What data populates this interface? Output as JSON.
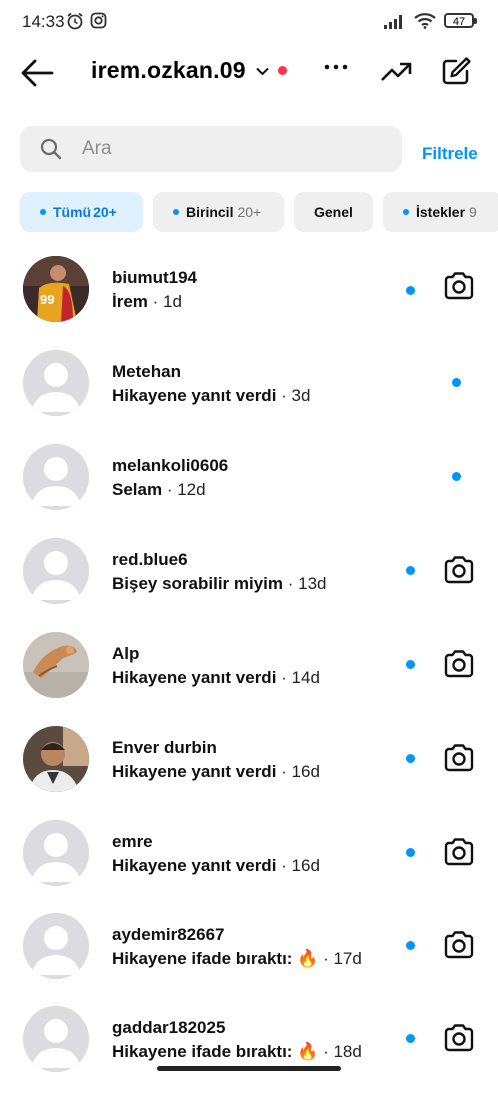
{
  "status_bar": {
    "time": "14:33",
    "battery": "47"
  },
  "header": {
    "username": "irem.ozkan.09"
  },
  "search": {
    "placeholder": "Ara",
    "filter_label": "Filtrele"
  },
  "chips": [
    {
      "label": "Tümü",
      "count": "20+",
      "active": true
    },
    {
      "label": "Birincil",
      "count": "20+",
      "active": false
    },
    {
      "label": "Genel",
      "count": "",
      "active": false
    },
    {
      "label": "İstekler",
      "count": "9",
      "active": false
    }
  ],
  "threads": [
    {
      "name": "biumut194",
      "preview": "İrem",
      "time": "· 1d",
      "unread": true,
      "camera": true
    },
    {
      "name": "Metehan",
      "preview": "Hikayene yanıt verdi",
      "time": "· 3d",
      "unread": true,
      "camera": false
    },
    {
      "name": "melankoli0606",
      "preview": "Selam",
      "time": "· 12d",
      "unread": true,
      "camera": false
    },
    {
      "name": "red.blue6",
      "preview": "Bişey sorabilir miyim",
      "time": "· 13d",
      "unread": true,
      "camera": true
    },
    {
      "name": "Alp",
      "preview": "Hikayene yanıt verdi",
      "time": "· 14d",
      "unread": true,
      "camera": true
    },
    {
      "name": "Enver durbin",
      "preview": "Hikayene yanıt verdi",
      "time": "· 16d",
      "unread": true,
      "camera": true
    },
    {
      "name": "emre",
      "preview": "Hikayene yanıt verdi",
      "time": "· 16d",
      "unread": true,
      "camera": true
    },
    {
      "name": "aydemir82667",
      "preview": "Hikayene ifade bıraktı: 🔥",
      "time": "· 17d",
      "unread": true,
      "camera": true
    },
    {
      "name": "gaddar182025",
      "preview": "Hikayene ifade bıraktı: 🔥",
      "time": "· 18d",
      "unread": true,
      "camera": true
    }
  ],
  "colors": {
    "accent": "#0095f6",
    "status_dot": "#ff3040",
    "chip_active_bg": "#dff1ff"
  }
}
